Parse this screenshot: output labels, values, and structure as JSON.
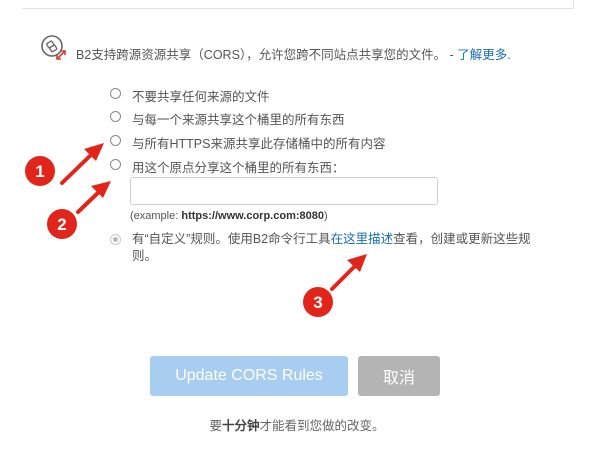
{
  "intro": {
    "icon": "b2-share-icon",
    "text": "B2支持跨源资源共享（CORS），允许您跨不同站点共享您的文件。 - ",
    "learn_more": "了解更多",
    "suffix": "."
  },
  "options": {
    "none": "不要共享任何来源的文件",
    "all_origins": "与每一个来源共享这个桶里的所有东西",
    "https_all": "与所有HTTPS来源共享此存储桶中的所有内容",
    "one_origin": "用这个原点分享这个桶里的所有东西："
  },
  "origin_input": {
    "value": "",
    "placeholder": ""
  },
  "example": {
    "prefix": "(example: ",
    "value": "https://www.corp.com:8080",
    "suffix": ")"
  },
  "custom": {
    "text_before": "有“自定义”规则。使用B2命令行工具",
    "link": "在这里描述",
    "text_after": "查看，创建或更新这些规则。"
  },
  "buttons": {
    "update": "Update CORS Rules",
    "cancel": "取消"
  },
  "footnote": {
    "prefix": "要",
    "bold": "十分钟",
    "suffix": "才能看到您做的改变。"
  },
  "annotations": [
    {
      "number": "1",
      "color": "#e1251b"
    },
    {
      "number": "2",
      "color": "#e1251b"
    },
    {
      "number": "3",
      "color": "#e1251b"
    }
  ],
  "colors": {
    "link": "#1a6ebd",
    "update_button": "#a9cdf0",
    "cancel_button": "#b4b4b4",
    "annotation": "#e1251b"
  }
}
